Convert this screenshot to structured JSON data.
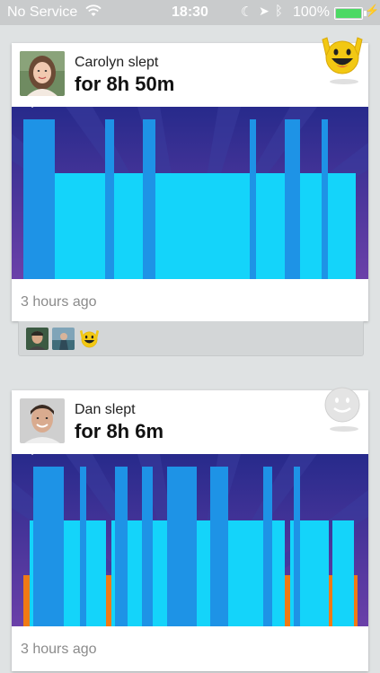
{
  "status_bar": {
    "carrier": "No Service",
    "time": "18:30",
    "battery": "100%"
  },
  "cards": [
    {
      "name": "Carolyn",
      "slept_label": "Carolyn slept",
      "duration": "for 8h 50m",
      "time_ago": "3 hours ago",
      "mood": "excited-smiley",
      "reactions": [
        "friend-avatar-1",
        "friend-avatar-2",
        "excited-smiley"
      ]
    },
    {
      "name": "Dan",
      "slept_label": "Dan slept",
      "duration": "for 8h 6m",
      "time_ago": "3 hours ago",
      "mood": "neutral-smiley"
    }
  ],
  "colors": {
    "deep_sleep": "#1e93e6",
    "light_sleep": "#14d4fa",
    "awake": "#f07a14",
    "bg_top": "#2a2c8c",
    "bg_bottom": "#6a3fa8"
  }
}
